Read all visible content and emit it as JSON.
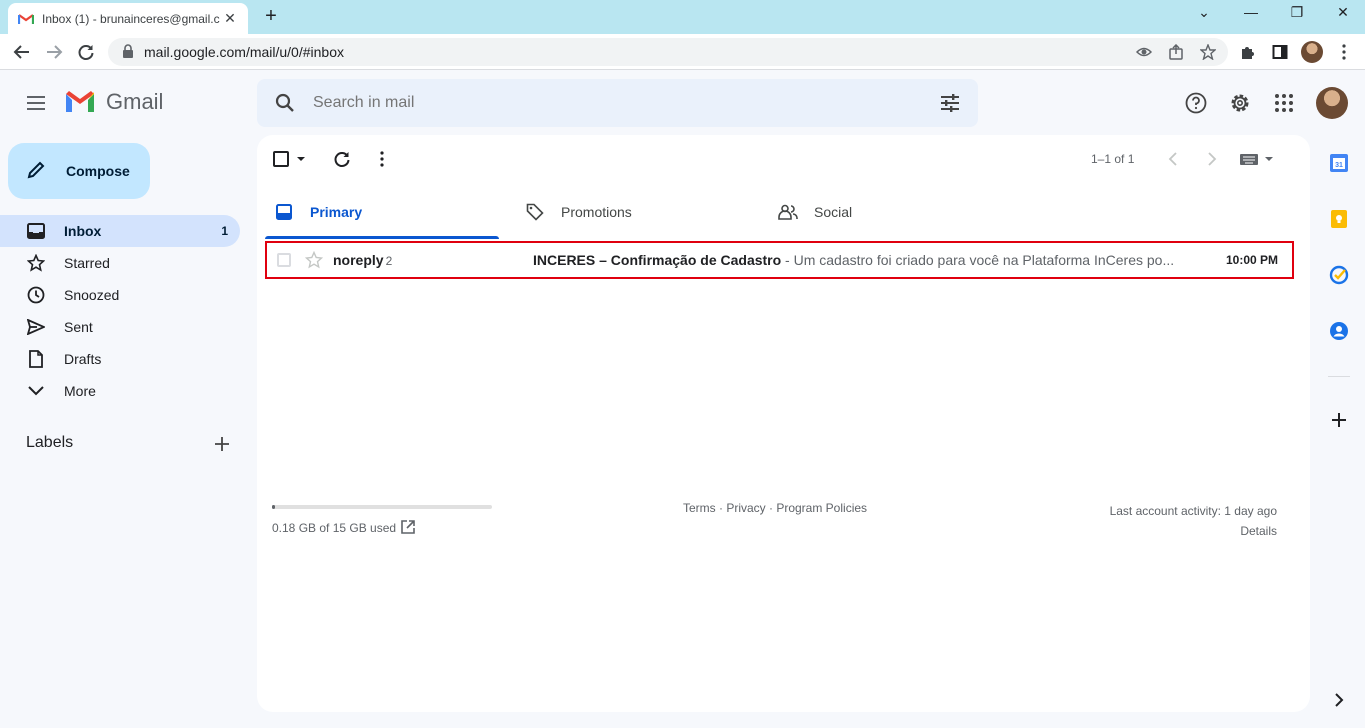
{
  "browser": {
    "tab_title": "Inbox (1) - brunainceres@gmail.c",
    "new_tab": "+",
    "url": "mail.google.com/mail/u/0/#inbox"
  },
  "header": {
    "app_name": "Gmail",
    "search_placeholder": "Search in mail"
  },
  "sidebar": {
    "compose": "Compose",
    "items": [
      {
        "label": "Inbox",
        "count": "1",
        "icon": "inbox-icon"
      },
      {
        "label": "Starred",
        "icon": "star-icon"
      },
      {
        "label": "Snoozed",
        "icon": "clock-icon"
      },
      {
        "label": "Sent",
        "icon": "send-icon"
      },
      {
        "label": "Drafts",
        "icon": "file-icon"
      },
      {
        "label": "More",
        "icon": "chevron-down-icon"
      }
    ],
    "labels_title": "Labels"
  },
  "main": {
    "pager": "1–1 of 1",
    "tabs": [
      {
        "label": "Primary"
      },
      {
        "label": "Promotions"
      },
      {
        "label": "Social"
      }
    ],
    "email": {
      "sender": "noreply",
      "thread_count": "2",
      "subject": "INCERES – Confirmação de Cadastro",
      "snippet": " - Um cadastro foi criado para você na Plataforma InCeres po...",
      "time": "10:00 PM"
    },
    "storage": {
      "text": "0.18 GB of 15 GB used",
      "fraction": 0.012
    },
    "footer_links": "Terms · Privacy · Program Policies",
    "activity": "Last account activity: 1 day ago",
    "details": "Details"
  },
  "colors": {
    "accent": "#0b57d0",
    "highlight_border": "#e0000f",
    "compose_bg": "#c2e7ff"
  }
}
